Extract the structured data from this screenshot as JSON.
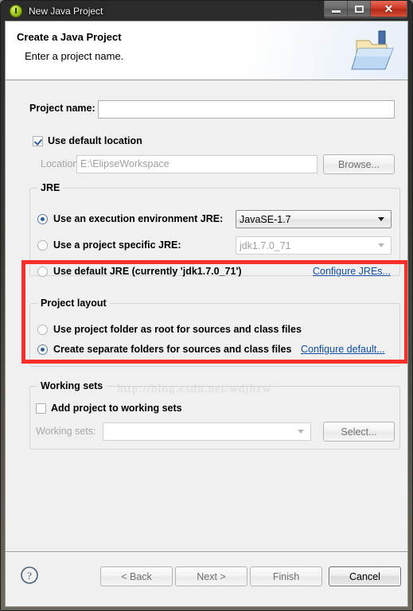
{
  "window": {
    "title": "New Java Project",
    "icon": "java-project-icon",
    "controls": {
      "minimize": "minimize-icon",
      "maximize": "maximize-icon",
      "close": "close-icon"
    }
  },
  "header": {
    "title": "Create a Java Project",
    "subtitle": "Enter a project name.",
    "banner_icon": "java-project-folder-icon"
  },
  "form": {
    "project_name_label": "Project name:",
    "project_name_value": "",
    "project_name_placeholder": "",
    "use_default_location_label": "Use default location",
    "use_default_location_checked": true,
    "location_label": "Location:",
    "location_value": "E:\\ElipseWorkspace",
    "browse_label": "Browse..."
  },
  "jre": {
    "group_title": "JRE",
    "highlight_color": "#f72f28",
    "options": [
      {
        "label": "Use an execution environment JRE:",
        "selected": true,
        "combo_value": "JavaSE-1.7",
        "combo_enabled": true
      },
      {
        "label": "Use a project specific JRE:",
        "selected": false,
        "combo_value": "jdk1.7.0_71",
        "combo_enabled": false
      },
      {
        "label": "Use default JRE (currently 'jdk1.7.0_71')",
        "selected": false
      }
    ],
    "configure_link": "Configure JREs..."
  },
  "project_layout": {
    "group_title": "Project layout",
    "options": [
      {
        "label": "Use project folder as root for sources and class files",
        "selected": false
      },
      {
        "label": "Create separate folders for sources and class files",
        "selected": true
      }
    ],
    "configure_link": "Configure default..."
  },
  "working_sets": {
    "group_title": "Working sets",
    "add_label": "Add project to working sets",
    "add_checked": false,
    "sets_label": "Working sets:",
    "sets_value": "",
    "select_label": "Select..."
  },
  "watermark": "http://blog.csdn.net/wdjhzw",
  "footer": {
    "help_icon": "help-icon",
    "buttons": [
      {
        "label": "< Back",
        "enabled": false
      },
      {
        "label": "Next >",
        "enabled": false
      },
      {
        "label": "Finish",
        "enabled": false
      },
      {
        "label": "Cancel",
        "enabled": true
      }
    ]
  }
}
